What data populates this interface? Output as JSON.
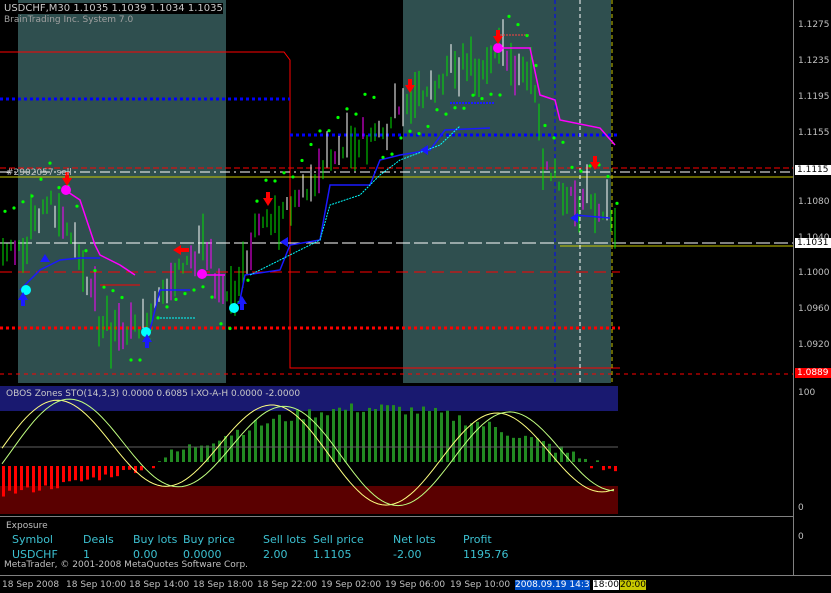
{
  "symbol_line": "USDCHF,M30  1.1035 1.1039 1.1034 1.1035",
  "broker_line": "BrainTrading Inc. System 7.0",
  "order_line_label": "#2902057 sell",
  "oscillator_header": "OBOS Zones  STO(14,3,3)  0.0000 0.6085  I-XO-A-H 0.0000 -2.0000",
  "price_ticks": [
    "1.1275",
    "1.1235",
    "1.1195",
    "1.1155",
    "1.1080",
    "1.1040",
    "1.1000",
    "1.0960",
    "1.0920"
  ],
  "price_tags": {
    "current": "1.1115",
    "bid": "1.1031",
    "lower": "1.0889"
  },
  "osc_ticks": [
    "100",
    "0",
    "0"
  ],
  "exposure": {
    "title": "Exposure",
    "headers": [
      "Symbol",
      "Deals",
      "Buy lots",
      "Buy price",
      "Sell lots",
      "Sell price",
      "Net lots",
      "Profit"
    ],
    "values": [
      "USDCHF",
      "1",
      "0.00",
      "0.0000",
      "2.00",
      "1.1105",
      "-2.00",
      "1195.76"
    ]
  },
  "copyright": "MetaTrader, © 2001-2008 MetaQuotes Software Corp.",
  "time_labels": [
    "18 Sep 2008",
    "18 Sep 10:00",
    "18 Sep 14:00",
    "18 Sep 18:00",
    "18 Sep 22:00",
    "19 Sep 02:00",
    "19 Sep 06:00",
    "19 Sep 10:00"
  ],
  "time_highlights": [
    "2008.09.19 14:3",
    "18:00",
    "20:00"
  ],
  "colors": {
    "session_fill": "#2f4f4f",
    "buy_arrow": "#0000ff",
    "sell_arrow": "#ff0000",
    "parabolic": "#00ff00",
    "stop_line": "#ff0000",
    "target_line": "#0000ff",
    "osc_bull": "#228b22",
    "osc_bear": "#ff0000"
  }
}
